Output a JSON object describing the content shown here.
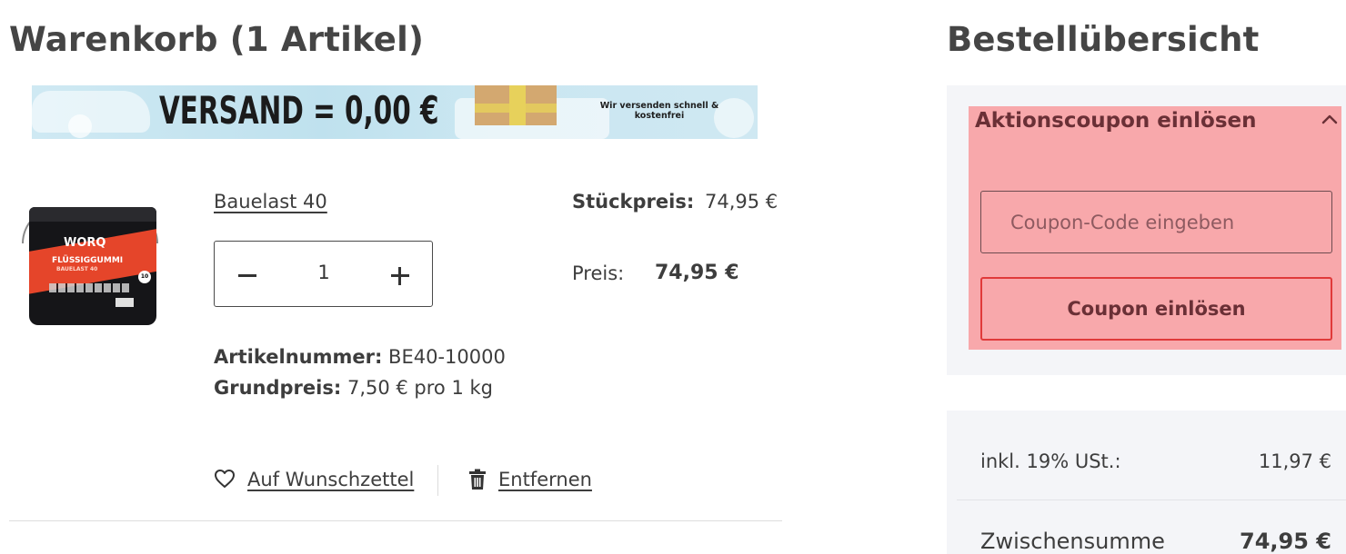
{
  "cart": {
    "title": "Warenkorb (1 Artikel)"
  },
  "banner": {
    "headline": "VERSAND = 0,00 €",
    "subtext": "Wir versenden schnell & kostenfrei"
  },
  "product": {
    "name": "Bauelast 40",
    "image_brand": "WORQ",
    "image_product": "FLÜSSIGGUMMI",
    "image_variant": "BAUELAST 40",
    "image_badge": "10",
    "quantity": "1",
    "unit_price_label": "Stückpreis:",
    "unit_price_value": "74,95 €",
    "price_label": "Preis:",
    "price_value": "74,95 €",
    "article_label": "Artikelnummer:",
    "article_value": "BE40-10000",
    "base_price_label": "Grundpreis:",
    "base_price_value": "7,50 € pro 1 kg",
    "wishlist_label": "Auf Wunschzettel",
    "remove_label": "Entfernen"
  },
  "summary": {
    "title": "Bestellübersicht",
    "coupon": {
      "title": "Aktionscoupon einlösen",
      "input_placeholder": "Coupon-Code eingeben",
      "input_value": "",
      "button_label": "Coupon einlösen"
    },
    "tax_label": "inkl. 19% USt.:",
    "tax_value": "11,97 €",
    "subtotal_label": "Zwischensumme",
    "subtotal_value": "74,95 €"
  },
  "colors": {
    "coupon_highlight": "#f8a8ab",
    "coupon_button_border": "#e03a3a",
    "card_background": "#f4f5f8",
    "text": "#3d3d3d"
  },
  "icons": {
    "quantity_decrease": "minus-icon",
    "quantity_increase": "plus-icon",
    "wishlist": "heart-icon",
    "remove": "trash-icon",
    "coupon_toggle": "chevron-up-icon"
  }
}
